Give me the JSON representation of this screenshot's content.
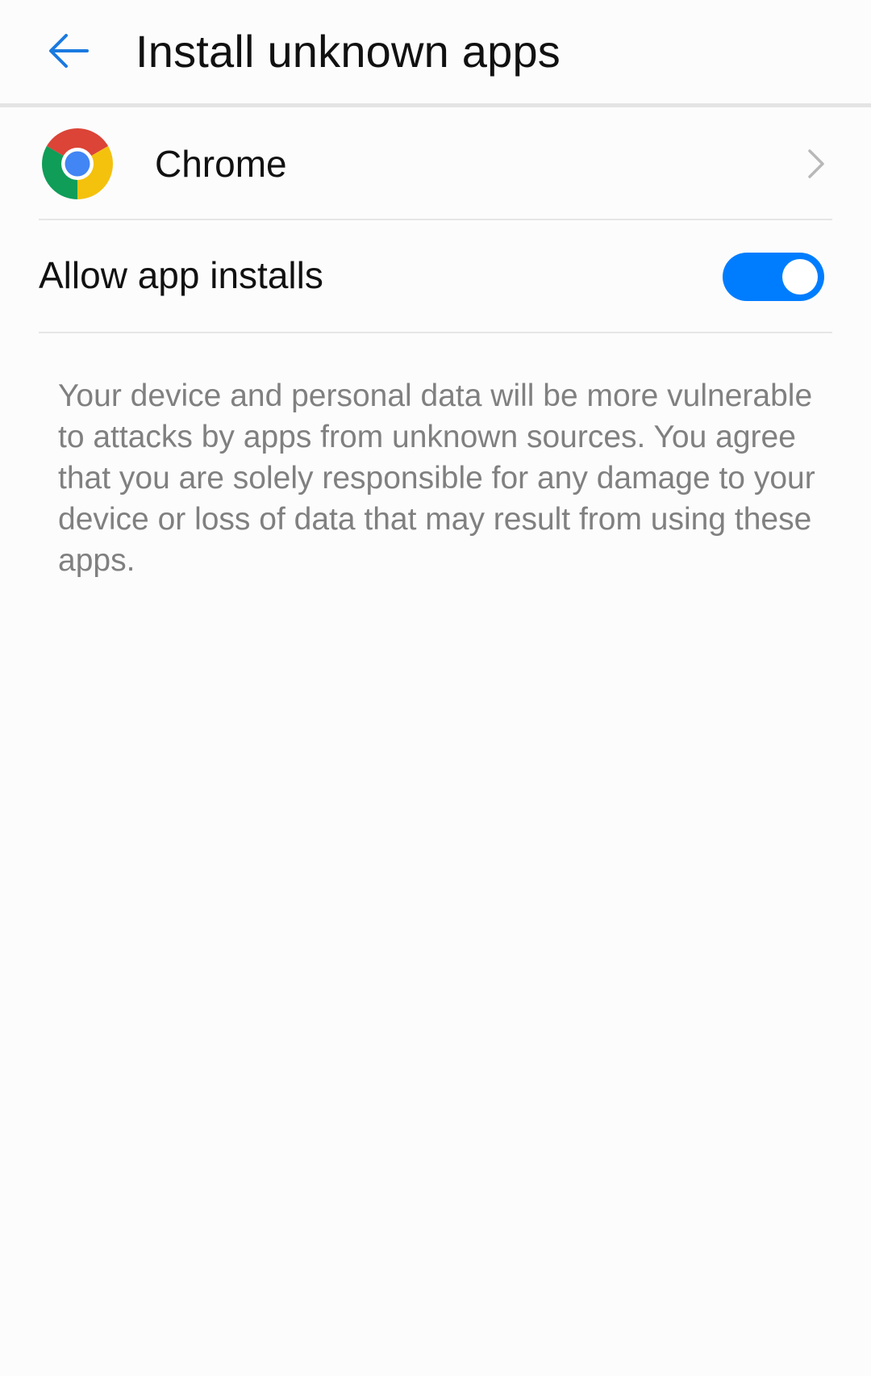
{
  "header": {
    "back_icon": "arrow-left-icon",
    "title": "Install unknown apps"
  },
  "app": {
    "icon": "chrome-logo-icon",
    "name": "Chrome",
    "chevron_icon": "chevron-right-icon"
  },
  "permission": {
    "label": "Allow app installs",
    "enabled": true,
    "accent_color": "#007dff"
  },
  "warning": {
    "text": "Your device and personal data will be more vulnerable to attacks by apps from unknown sources. You agree that you are solely responsible for any damage to your device or loss of data that may result from using these apps."
  }
}
